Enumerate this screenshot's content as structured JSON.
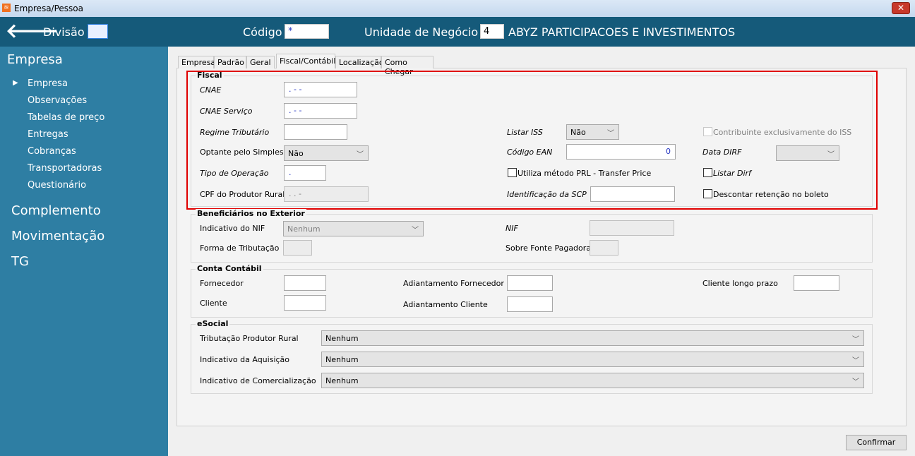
{
  "window": {
    "title": "Empresa/Pessoa",
    "close": "✕"
  },
  "header": {
    "divisao_label": "Divisão",
    "divisao_value": "",
    "codigo_label": "Código",
    "codigo_value": "*",
    "unidade_label": "Unidade de Negócio",
    "unidade_code": "4",
    "unidade_name": "ABYZ PARTICIPACOES E INVESTIMENTOS"
  },
  "sidebar": {
    "sections": [
      "Empresa",
      "Complemento",
      "Movimentação",
      "TG"
    ],
    "items": [
      "Empresa",
      "Observações",
      "Tabelas de preço",
      "Entregas",
      "Cobranças",
      "Transportadoras",
      "Questionário"
    ]
  },
  "tabs": [
    "Empresa",
    "Padrão",
    "Geral",
    "Fiscal/Contábil",
    "Localização",
    "Como Chegar"
  ],
  "fiscal": {
    "title": "Fiscal",
    "cnae_label": "CNAE",
    "cnae_value": " .  - -",
    "cnae_servico_label": "CNAE Serviço",
    "cnae_servico_value": " .  - -",
    "regime_label": "Regime Tributário",
    "regime_value": "",
    "optante_label": "Optante pelo Simples",
    "optante_value": "Não",
    "tipo_op_label": "Tipo de Operação",
    "tipo_op_value": " .",
    "cpf_label": "CPF do Produtor Rural",
    "cpf_value": " .   .   -",
    "listar_iss_label": "Listar  ISS",
    "listar_iss_value": "Não",
    "ean_label": "Código EAN",
    "ean_value": "0",
    "prl_label": "Utiliza método PRL - Transfer Price",
    "scp_label": "Identificação da SCP",
    "scp_value": "",
    "contrib_label": "Contribuinte exclusivamente do ISS",
    "dirf_label": "Data DIRF",
    "dirf_value": "",
    "listar_dirf_label": "Listar Dirf",
    "descontar_label": "Descontar retenção no boleto"
  },
  "benef": {
    "title": "Beneficiários no Exterior",
    "nif_ind_label": "Indicativo do NIF",
    "nif_ind_value": "Nenhum",
    "nif_label": "NIF",
    "forma_label": "Forma de Tributação",
    "fonte_label": "Sobre Fonte Pagadora"
  },
  "conta": {
    "title": "Conta Contábil",
    "fornecedor": "Fornecedor",
    "cliente": "Cliente",
    "ad_fornecedor": "Adiantamento Fornecedor",
    "ad_cliente": "Adiantamento Cliente",
    "cliente_lp": "Cliente longo prazo"
  },
  "esocial": {
    "title": "eSocial",
    "trib_label": "Tributação Produtor Rural",
    "trib_value": "Nenhum",
    "aquis_label": "Indicativo da Aquisição",
    "aquis_value": "Nenhum",
    "comerc_label": "Indicativo de Comercialização",
    "comerc_value": "Nenhum"
  },
  "confirm": "Confirmar"
}
